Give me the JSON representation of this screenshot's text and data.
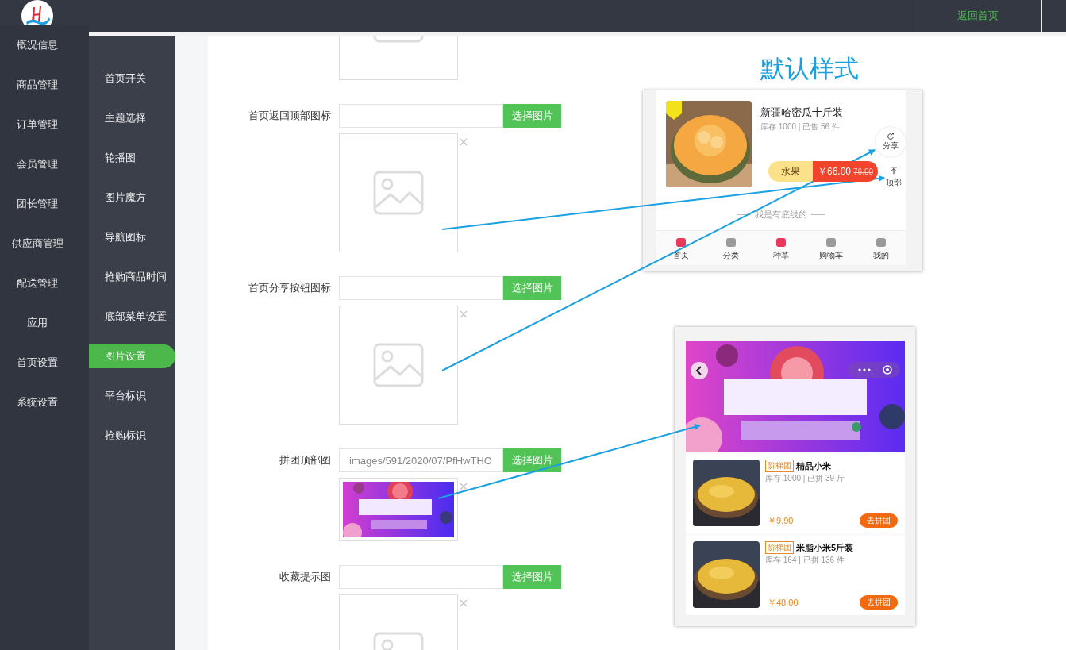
{
  "header": {
    "home_link": "返回首页"
  },
  "sidebar": {
    "items": [
      {
        "label": "概况信息"
      },
      {
        "label": "商品管理"
      },
      {
        "label": "订单管理"
      },
      {
        "label": "会员管理"
      },
      {
        "label": "团长管理"
      },
      {
        "label": "供应商管理"
      },
      {
        "label": "配送管理"
      },
      {
        "label": "应用"
      },
      {
        "label": "首页设置"
      },
      {
        "label": "系统设置"
      }
    ]
  },
  "subnav": {
    "items": [
      {
        "label": "首页开关",
        "selected": false
      },
      {
        "label": "主题选择",
        "selected": false
      },
      {
        "label": "轮播图",
        "selected": false
      },
      {
        "label": "图片魔方",
        "selected": false
      },
      {
        "label": "导航图标",
        "selected": false
      },
      {
        "label": "抢购商品时间",
        "selected": false
      },
      {
        "label": "底部菜单设置",
        "selected": false
      },
      {
        "label": "图片设置",
        "selected": true
      },
      {
        "label": "平台标识",
        "selected": false
      },
      {
        "label": "抢购标识",
        "selected": false
      }
    ]
  },
  "form": {
    "fields": [
      {
        "kind": "empty"
      },
      {
        "label": "首页返回顶部图标",
        "button": "选择图片",
        "kind": "empty"
      },
      {
        "label": "首页分享按钮图标",
        "button": "选择图片",
        "kind": "empty"
      },
      {
        "label": "拼团顶部图",
        "value": "images/591/2020/07/PfHwTHO",
        "button": "选择图片",
        "kind": "picture"
      },
      {
        "label": "收藏提示图",
        "button": "选择图片",
        "kind": "empty"
      }
    ]
  },
  "preview": {
    "title": "默认样式",
    "default": {
      "product": {
        "name": "新疆哈密瓜十斤装",
        "meta": "库存 1000 | 已售 56 件",
        "category": "水果",
        "price": "￥66.00",
        "old_price": "76.00"
      },
      "share_label": "分享",
      "top_label": "顶部",
      "end_note": "我是有底线的",
      "tabs": [
        {
          "label": "首页",
          "color": "#e8395a"
        },
        {
          "label": "分类",
          "color": "#9a9a9a"
        },
        {
          "label": "种草",
          "color": "#e8395a"
        },
        {
          "label": "购物车",
          "color": "#9a9a9a"
        },
        {
          "label": "我的",
          "color": "#9a9a9a"
        }
      ]
    },
    "group": {
      "items": [
        {
          "tag": "阶梯团",
          "name": "精品小米",
          "meta": "库存 1000 | 已拼 39 斤",
          "price": "￥9.90",
          "button": "去拼团"
        },
        {
          "tag": "阶梯团",
          "name": "米脂小米5斤装",
          "meta": "库存 164 | 已拼 136 件",
          "price": "￥48.00",
          "button": "去拼团"
        }
      ]
    }
  }
}
